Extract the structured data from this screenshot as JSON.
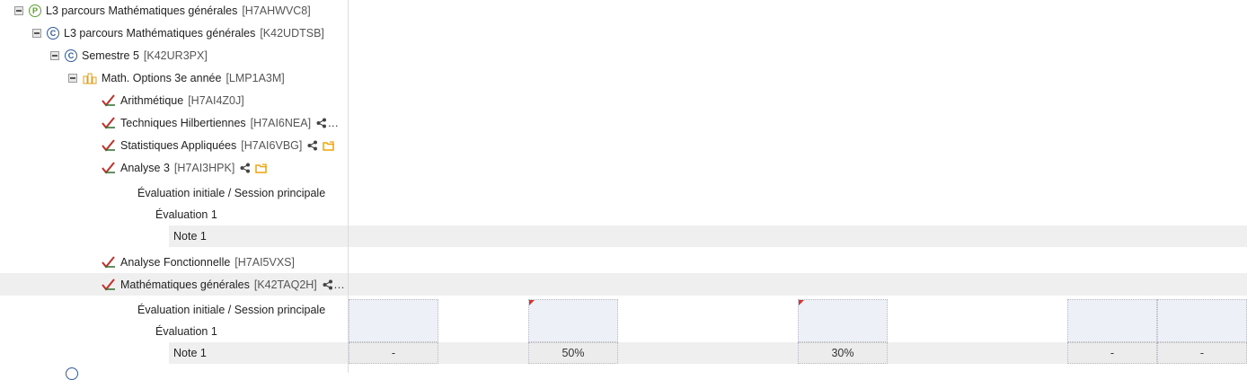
{
  "tree": {
    "program": {
      "label": "L3 parcours Mathématiques générales",
      "code": "[H7AHWVC8]",
      "badge": "P"
    },
    "course": {
      "label": "L3 parcours Mathématiques générales",
      "code": "[K42UDTSB]",
      "badge": "C"
    },
    "semester": {
      "label": "Semestre 5",
      "code": "[K42UR3PX]",
      "badge": "C"
    },
    "option": {
      "label": "Math. Options 3e année",
      "code": "[LMP1A3M]"
    },
    "modules": [
      {
        "label": "Arithmétique",
        "code": "[H7AI4Z0J]"
      },
      {
        "label": "Techniques Hilbertiennes",
        "code": "[H7AI6NEA]",
        "more": "..."
      },
      {
        "label": "Statistiques Appliquées",
        "code": "[H7AI6VBG]"
      },
      {
        "label": "Analyse 3",
        "code": "[H7AI3HPK]"
      }
    ],
    "analyse3_eval": {
      "session": "Évaluation initiale / Session principale",
      "evaluation": "Évaluation 1",
      "note": "Note 1"
    },
    "modules2": [
      {
        "label": "Analyse Fonctionnelle",
        "code": "[H7AI5VXS]"
      },
      {
        "label": "Mathématiques générales",
        "code": "[K42TAQ2H]",
        "more": "..."
      }
    ],
    "mathgen_eval": {
      "session": "Évaluation initiale / Session principale",
      "evaluation": "Évaluation 1",
      "note": "Note 1"
    }
  },
  "grid": {
    "note_values": [
      "-",
      "50%",
      "30%",
      "-",
      "-"
    ]
  },
  "colors": {
    "flag": "#d9312b",
    "program": "#5aa02c",
    "course": "#2f5a9b",
    "folder": "#f0a30a"
  }
}
